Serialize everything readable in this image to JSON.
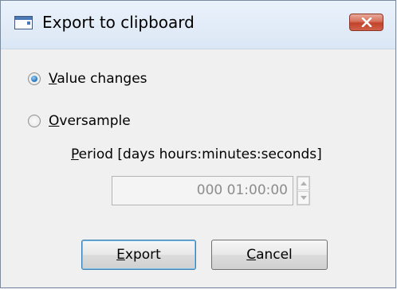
{
  "window": {
    "title": "Export to clipboard"
  },
  "options": {
    "value_changes": {
      "mnemonic": "V",
      "rest": "alue changes",
      "checked": true
    },
    "oversample": {
      "mnemonic": "O",
      "rest": "versample",
      "checked": false
    }
  },
  "period": {
    "label_mnemonic": "P",
    "label_rest": "eriod [days hours:minutes:seconds]",
    "value": "000 01:00:00",
    "enabled": false
  },
  "buttons": {
    "export": {
      "mnemonic": "E",
      "rest": "xport"
    },
    "cancel": {
      "mnemonic": "C",
      "rest": "ancel"
    }
  },
  "icons": [
    "app-icon",
    "close-icon",
    "spin-up-icon",
    "spin-down-icon"
  ]
}
